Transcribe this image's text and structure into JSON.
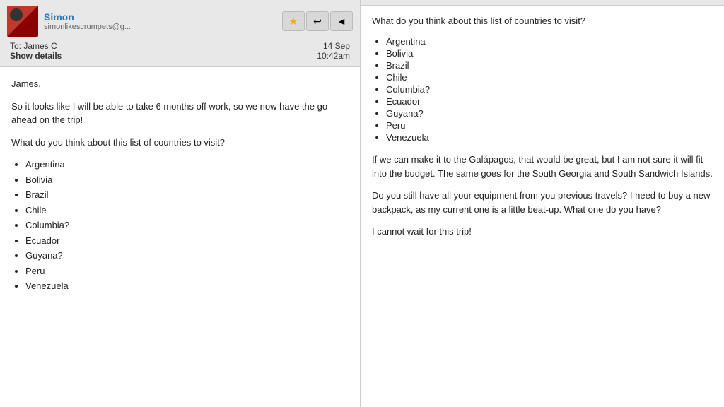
{
  "email": {
    "sender": {
      "name": "Simon",
      "email": "simonlikescrumpets@g..."
    },
    "to": "To: James C",
    "show_details": "Show details",
    "date": "14 Sep",
    "time": "10:42am",
    "body": {
      "greeting": "James,",
      "paragraph1": "So it looks like I will be able to take 6 months off work, so we now have the go-ahead on the trip!",
      "paragraph2": "What do you think about this list of countries to visit?",
      "countries": [
        "Argentina",
        "Bolivia",
        "Brazil",
        "Chile",
        "Columbia?",
        "Ecuador",
        "Guyana?",
        "Peru",
        "Venezuela"
      ],
      "paragraph3": "If we can make it to the Galápagos, that would be great, but I am not sure it will fit into the budget. The same goes for the South Georgia and South Sandwich Islands.",
      "paragraph4": "Do you still have all your equipment from you previous travels? I need to buy a new backpack, as my current one is a little beat-up. What one do you have?",
      "paragraph5": "I cannot wait for this trip!"
    }
  },
  "right_panel": {
    "intro": "What do you think about this list of countries to visit?",
    "countries": [
      "Argentina",
      "Bolivia",
      "Brazil",
      "Chile",
      "Columbia?",
      "Ecuador",
      "Guyana?",
      "Peru",
      "Venezuela"
    ],
    "galapagos": "If we can make it to the Galápagos, that would be great, but I am not sure it will fit into the budget. The same goes for the South Georgia and South Sandwich Islands.",
    "equipment": "Do you still have all your equipment from you previous travels? I need to buy a new backpack, as my current one is a little beat-up. What one do you have?",
    "closing": "I cannot wait for this trip!"
  },
  "actions": {
    "star_icon": "★",
    "reply_icon": "↩",
    "back_icon": "◄"
  }
}
